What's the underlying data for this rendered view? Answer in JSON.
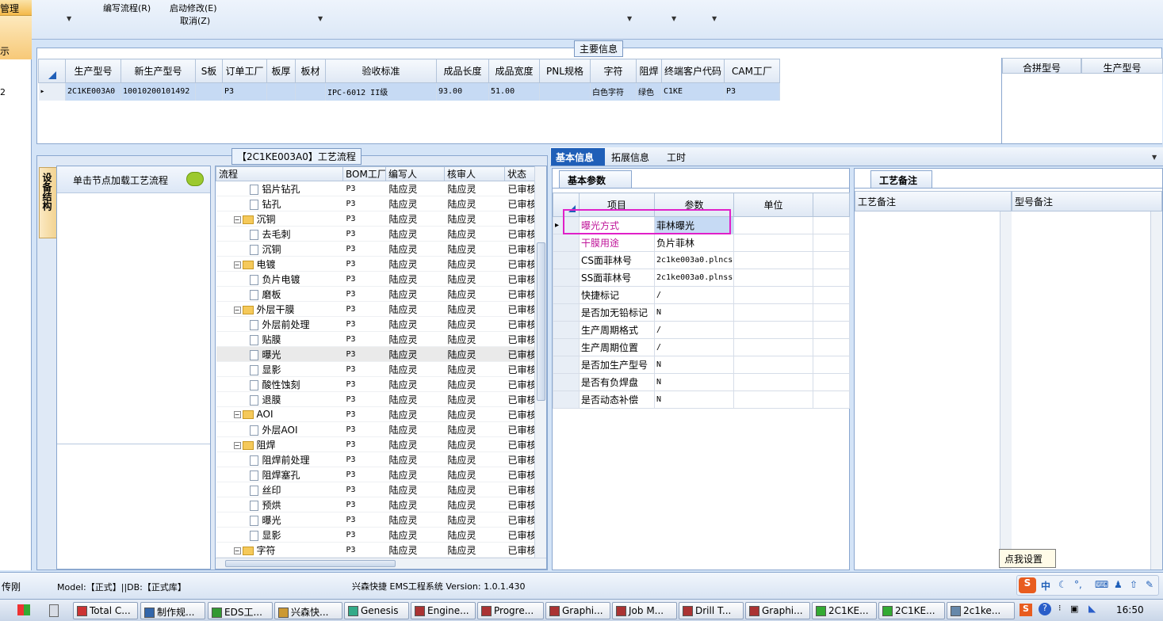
{
  "left_strip": {
    "tab1": "管理",
    "tab2": "示",
    "item": "2"
  },
  "menu": {
    "edit_flow": "编写流程(R)",
    "start_modify": "启动修改(E)",
    "cancel": "取消(Z)"
  },
  "main_info": {
    "title": "主要信息",
    "columns": [
      "生产型号",
      "新生产型号",
      "S板",
      "订单工厂",
      "板厚",
      "板材",
      "验收标准",
      "成品长度",
      "成品宽度",
      "PNL规格",
      "字符",
      "阻焊",
      "终端客户代码",
      "CAM工厂"
    ],
    "row": [
      "2C1KE003A0",
      "10010200101492",
      "",
      "P3",
      "",
      "",
      "IPC-6012 II级",
      "93.00",
      "51.00",
      "",
      "白色字符",
      "绿色",
      "C1KE",
      "P3"
    ],
    "side_columns": [
      "合拼型号",
      "生产型号"
    ]
  },
  "process": {
    "title": "【2C1KE003A0】工艺流程",
    "side_tab": "设备结构",
    "hint": "单击节点加载工艺流程",
    "columns": [
      "流程",
      "BOM工厂",
      "编写人",
      "核审人",
      "状态"
    ],
    "rows": [
      {
        "name": "铝片钻孔",
        "level": 2,
        "type": "doc",
        "bom": "P3",
        "writer": "陆应灵",
        "reviewer": "陆应灵",
        "status": "已审核"
      },
      {
        "name": "钻孔",
        "level": 2,
        "type": "doc",
        "bom": "P3",
        "writer": "陆应灵",
        "reviewer": "陆应灵",
        "status": "已审核"
      },
      {
        "name": "沉铜",
        "level": 1,
        "type": "folder",
        "bom": "P3",
        "writer": "陆应灵",
        "reviewer": "陆应灵",
        "status": "已审核"
      },
      {
        "name": "去毛刺",
        "level": 2,
        "type": "doc",
        "bom": "P3",
        "writer": "陆应灵",
        "reviewer": "陆应灵",
        "status": "已审核"
      },
      {
        "name": "沉铜",
        "level": 2,
        "type": "doc",
        "bom": "P3",
        "writer": "陆应灵",
        "reviewer": "陆应灵",
        "status": "已审核"
      },
      {
        "name": "电镀",
        "level": 1,
        "type": "folder",
        "bom": "P3",
        "writer": "陆应灵",
        "reviewer": "陆应灵",
        "status": "已审核"
      },
      {
        "name": "负片电镀",
        "level": 2,
        "type": "doc",
        "bom": "P3",
        "writer": "陆应灵",
        "reviewer": "陆应灵",
        "status": "已审核"
      },
      {
        "name": "磨板",
        "level": 2,
        "type": "doc",
        "bom": "P3",
        "writer": "陆应灵",
        "reviewer": "陆应灵",
        "status": "已审核"
      },
      {
        "name": "外层干膜",
        "level": 1,
        "type": "folder",
        "bom": "P3",
        "writer": "陆应灵",
        "reviewer": "陆应灵",
        "status": "已审核"
      },
      {
        "name": "外层前处理",
        "level": 2,
        "type": "doc",
        "bom": "P3",
        "writer": "陆应灵",
        "reviewer": "陆应灵",
        "status": "已审核"
      },
      {
        "name": "贴膜",
        "level": 2,
        "type": "doc",
        "bom": "P3",
        "writer": "陆应灵",
        "reviewer": "陆应灵",
        "status": "已审核"
      },
      {
        "name": "曝光",
        "level": 2,
        "type": "doc",
        "bom": "P3",
        "writer": "陆应灵",
        "reviewer": "陆应灵",
        "status": "已审核",
        "selected": true
      },
      {
        "name": "显影",
        "level": 2,
        "type": "doc",
        "bom": "P3",
        "writer": "陆应灵",
        "reviewer": "陆应灵",
        "status": "已审核"
      },
      {
        "name": "酸性蚀刻",
        "level": 2,
        "type": "doc",
        "bom": "P3",
        "writer": "陆应灵",
        "reviewer": "陆应灵",
        "status": "已审核"
      },
      {
        "name": "退膜",
        "level": 2,
        "type": "doc",
        "bom": "P3",
        "writer": "陆应灵",
        "reviewer": "陆应灵",
        "status": "已审核"
      },
      {
        "name": "AOI",
        "level": 1,
        "type": "folder",
        "bom": "P3",
        "writer": "陆应灵",
        "reviewer": "陆应灵",
        "status": "已审核"
      },
      {
        "name": "外层AOI",
        "level": 2,
        "type": "doc",
        "bom": "P3",
        "writer": "陆应灵",
        "reviewer": "陆应灵",
        "status": "已审核"
      },
      {
        "name": "阻焊",
        "level": 1,
        "type": "folder",
        "bom": "P3",
        "writer": "陆应灵",
        "reviewer": "陆应灵",
        "status": "已审核"
      },
      {
        "name": "阻焊前处理",
        "level": 2,
        "type": "doc",
        "bom": "P3",
        "writer": "陆应灵",
        "reviewer": "陆应灵",
        "status": "已审核"
      },
      {
        "name": "阻焊塞孔",
        "level": 2,
        "type": "doc",
        "bom": "P3",
        "writer": "陆应灵",
        "reviewer": "陆应灵",
        "status": "已审核"
      },
      {
        "name": "丝印",
        "level": 2,
        "type": "doc",
        "bom": "P3",
        "writer": "陆应灵",
        "reviewer": "陆应灵",
        "status": "已审核"
      },
      {
        "name": "预烘",
        "level": 2,
        "type": "doc",
        "bom": "P3",
        "writer": "陆应灵",
        "reviewer": "陆应灵",
        "status": "已审核"
      },
      {
        "name": "曝光",
        "level": 2,
        "type": "doc",
        "bom": "P3",
        "writer": "陆应灵",
        "reviewer": "陆应灵",
        "status": "已审核"
      },
      {
        "name": "显影",
        "level": 2,
        "type": "doc",
        "bom": "P3",
        "writer": "陆应灵",
        "reviewer": "陆应灵",
        "status": "已审核"
      },
      {
        "name": "字符",
        "level": 1,
        "type": "folder",
        "bom": "P3",
        "writer": "陆应灵",
        "reviewer": "陆应灵",
        "status": "已审核"
      }
    ]
  },
  "info_tabs": [
    "基本信息",
    "拓展信息",
    "工时"
  ],
  "basic_params": {
    "tab": "基本参数",
    "columns": [
      "项目",
      "参数",
      "单位"
    ],
    "rows": [
      {
        "item": "曝光方式",
        "value": "菲林曝光",
        "unit": "",
        "pink": true
      },
      {
        "item": "干膜用途",
        "value": "负片菲林",
        "unit": "",
        "pink": true
      },
      {
        "item": "CS面菲林号",
        "value": "2c1ke003a0.plncs",
        "unit": ""
      },
      {
        "item": "SS面菲林号",
        "value": "2c1ke003a0.plnss",
        "unit": ""
      },
      {
        "item": "快捷标记",
        "value": "/",
        "unit": ""
      },
      {
        "item": "是否加无铅标记",
        "value": "N",
        "unit": ""
      },
      {
        "item": "生产周期格式",
        "value": "/",
        "unit": ""
      },
      {
        "item": "生产周期位置",
        "value": "/",
        "unit": ""
      },
      {
        "item": "是否加生产型号",
        "value": "N",
        "unit": ""
      },
      {
        "item": "是否有负焊盘",
        "value": "N",
        "unit": ""
      },
      {
        "item": "是否动态补偿",
        "value": "N",
        "unit": ""
      }
    ]
  },
  "remarks": {
    "tab": "工艺备注",
    "col1": "工艺备注",
    "col2": "型号备注",
    "tooltip": "点我设置"
  },
  "status_bar": {
    "user": "传刚",
    "model_db": "Model:【正式】||DB:【正式库】",
    "system": "兴森快捷 EMS工程系统 Version: 1.0.1.430"
  },
  "taskbar": {
    "items": [
      "Total C...",
      "制作规...",
      "EDS工...",
      "兴森快...",
      "Genesis",
      "Engine...",
      "Progre...",
      "Graphi...",
      "Job M...",
      "Drill T...",
      "Graphi...",
      "2C1KE...",
      "2C1KE...",
      "2c1ke..."
    ],
    "clock": "16:50",
    "ime": "中"
  },
  "colors": {
    "accent": "#1f5fb8",
    "pink": "#c0169a",
    "highlight": "#e020c8",
    "selected_row": "#c6daf4"
  }
}
